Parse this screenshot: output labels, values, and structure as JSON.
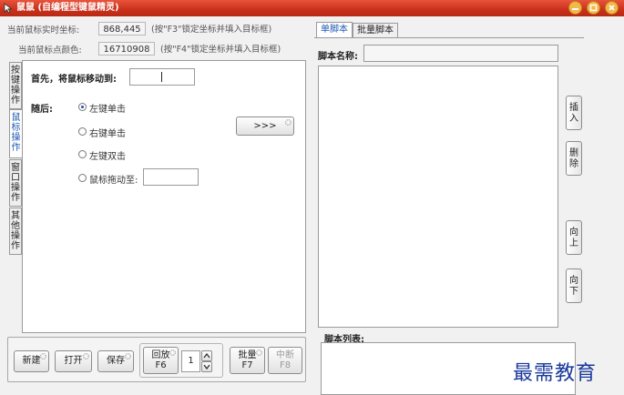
{
  "window": {
    "title": "鼠鼠 (自编程型键鼠精灵)"
  },
  "info": {
    "coords_label": "当前鼠标实时坐标:",
    "coords_value": "868,445",
    "coords_hint": "(按\"F3\"锁定坐标并填入目标框)",
    "color_label": "当前鼠标点颜色:",
    "color_value": "16710908",
    "color_hint": "(按\"F4\"锁定坐标并填入目标框)"
  },
  "left_tabs": [
    {
      "label": "按键操作"
    },
    {
      "label": "鼠标操作"
    },
    {
      "label": "窗口操作"
    },
    {
      "label": "其他操作"
    }
  ],
  "mouse_panel": {
    "first_label": "首先，将鼠标移动到:",
    "then_label": "随后:",
    "options": [
      {
        "label": "左键单击",
        "selected": true
      },
      {
        "label": "右键单击",
        "selected": false
      },
      {
        "label": "左键双击",
        "selected": false
      },
      {
        "label": "鼠标拖动至:",
        "selected": false
      }
    ],
    "add_button": ">>>"
  },
  "toolbar": {
    "new": "新建",
    "open": "打开",
    "save": "保存",
    "playback": "回放",
    "playback_key": "F6",
    "repeat_count": "1",
    "batch": "批量",
    "batch_key": "F7",
    "stop": "中断",
    "stop_key": "F8"
  },
  "right_tabs": [
    {
      "label": "单脚本",
      "active": true
    },
    {
      "label": "批量脚本",
      "active": false
    }
  ],
  "script": {
    "name_label": "脚本名称:",
    "list_label": "脚本列表:"
  },
  "side_buttons": [
    {
      "label": "插入"
    },
    {
      "label": "删除"
    },
    {
      "label": "向上"
    },
    {
      "label": "向下"
    }
  ],
  "watermark": "最需教育"
}
